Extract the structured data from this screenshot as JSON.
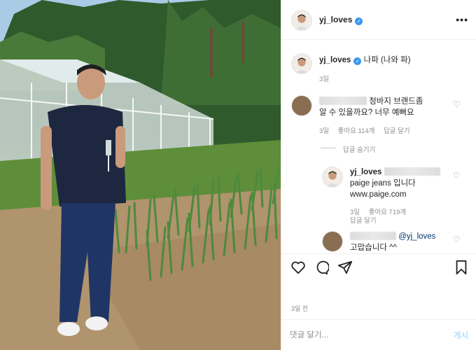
{
  "post": {
    "username": "yj_loves",
    "caption": "나파 (나와 파)",
    "caption_time": "3일",
    "date": "3일 전"
  },
  "header": {
    "username": "yj_loves",
    "more_label": "•••"
  },
  "comments": [
    {
      "text": "청바지 브랜드좀 알 수 있을까요? 너무 예뻐요",
      "time": "3일",
      "likes": "좋아요 114개",
      "reply": "답글 달기",
      "hide_replies": "답글 숨기기"
    },
    {
      "username": "yj_loves",
      "text_line1": "paige jeans 입니다",
      "text_line2": "www.paige.com",
      "time": "3일",
      "likes": "좋아요 719개",
      "reply": "답글 달기"
    },
    {
      "mention": "@yj_loves",
      "text": "고맙습니다 ^^"
    }
  ],
  "composer": {
    "placeholder": "댓글 달기...",
    "post_label": "게시"
  },
  "icons": [
    "heart-icon",
    "comment-icon",
    "share-icon",
    "bookmark-icon",
    "verified-badge-icon",
    "more-icon"
  ],
  "colors": {
    "verified": "#3897f0",
    "post_button_disabled": "#b2dffc",
    "muted_text": "#8e8e8e",
    "divider": "#efefef"
  }
}
